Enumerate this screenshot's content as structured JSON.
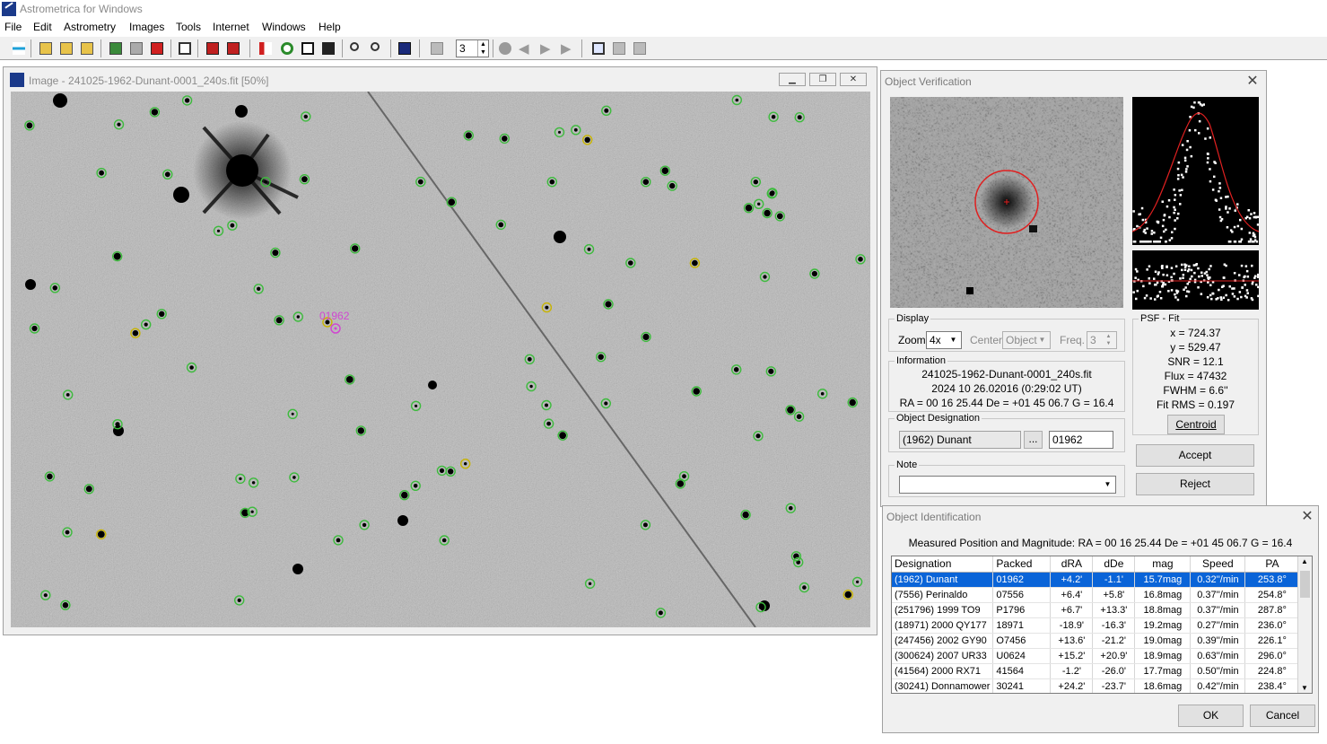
{
  "app": {
    "title": "Astrometrica for Windows"
  },
  "menu": [
    "File",
    "Edit",
    "Astrometry",
    "Images",
    "Tools",
    "Internet",
    "Windows",
    "Help"
  ],
  "toolbar": {
    "stepper_value": "3",
    "icons": [
      "open-image-icon",
      "load-images-icon",
      "load-dark-icon",
      "load-flat-icon",
      "star-icon",
      "blink-icon",
      "settings-icon",
      "reference-stars-icon",
      "data-reduction-icon",
      "moving-object-icon",
      "known-objects-icon",
      "track-and-stack-icon",
      "zoom-in-icon",
      "zoom-out-icon",
      "image-display-icon",
      "blink-settings-icon",
      "play-icon",
      "previous-icon",
      "next-icon",
      "last-icon",
      "select-image-icon",
      "window-icon"
    ]
  },
  "image_window": {
    "title": "Image - 241025-1962-Dunant-0001_240s.fit [50%]",
    "asteroid_label": "01962"
  },
  "verification": {
    "title": "Object Verification",
    "display": {
      "legend": "Display",
      "zoom_label": "Zoom",
      "zoom_value": "4x",
      "center_label": "Center",
      "center_value": "Object",
      "freq_label": "Freq.",
      "freq_value": "3"
    },
    "information": {
      "legend": "Information",
      "file": "241025-1962-Dunant-0001_240s.fit",
      "date": "2024 10 26.02016 (0:29:02 UT)",
      "coords": "RA = 00 16 25.44   De = +01 45 06.7   G = 16.4"
    },
    "designation": {
      "legend": "Object Designation",
      "name": "(1962) Dunant",
      "browse_label": "...",
      "packed": "01962"
    },
    "note": {
      "legend": "Note",
      "value": ""
    },
    "psf": {
      "legend": "PSF - Fit",
      "x": "x = 724.37",
      "y": "y = 529.47",
      "snr": "SNR = 12.1",
      "flux": "Flux = 47432",
      "fwhm": "FWHM = 6.6''",
      "rms": "Fit RMS = 0.197",
      "centroid_label": "Centroid"
    },
    "accept_label": "Accept",
    "reject_label": "Reject"
  },
  "identification": {
    "title": "Object Identification",
    "measured": "Measured Position and Magnitude: RA = 00 16 25.44   De = +01 45 06.7   G = 16.4",
    "columns": [
      "Designation",
      "Packed",
      "dRA",
      "dDe",
      "mag",
      "Speed",
      "PA"
    ],
    "rows": [
      [
        "(1962) Dunant",
        "01962",
        "+4.2'",
        "-1.1'",
        "15.7mag",
        "0.32''/min",
        "253.8°"
      ],
      [
        "(7556) Perinaldo",
        "07556",
        "+6.4'",
        "+5.8'",
        "16.8mag",
        "0.37''/min",
        "254.8°"
      ],
      [
        "(251796) 1999 TO9",
        "P1796",
        "+6.7'",
        "+13.3'",
        "18.8mag",
        "0.37''/min",
        "287.8°"
      ],
      [
        "(18971) 2000 QY177",
        "18971",
        "-18.9'",
        "-16.3'",
        "19.2mag",
        "0.27''/min",
        "236.0°"
      ],
      [
        "(247456) 2002 GY90",
        "O7456",
        "+13.6'",
        "-21.2'",
        "19.0mag",
        "0.39''/min",
        "226.1°"
      ],
      [
        "(300624) 2007 UR33",
        "U0624",
        "+15.2'",
        "+20.9'",
        "18.9mag",
        "0.63''/min",
        "296.0°"
      ],
      [
        "(41564) 2000 RX71",
        "41564",
        "-1.2'",
        "-26.0'",
        "17.7mag",
        "0.50''/min",
        "224.8°"
      ],
      [
        "(30241) Donnamower",
        "30241",
        "+24.2'",
        "-23.7'",
        "18.6mag",
        "0.42''/min",
        "238.4°"
      ]
    ],
    "ok_label": "OK",
    "cancel_label": "Cancel"
  },
  "colors": {
    "selection": "#0a64d8",
    "marker_green": "#3dbb3d",
    "marker_yellow": "#c8b400",
    "asteroid_magenta": "#d048d0",
    "fit_curve": "#e02020"
  }
}
